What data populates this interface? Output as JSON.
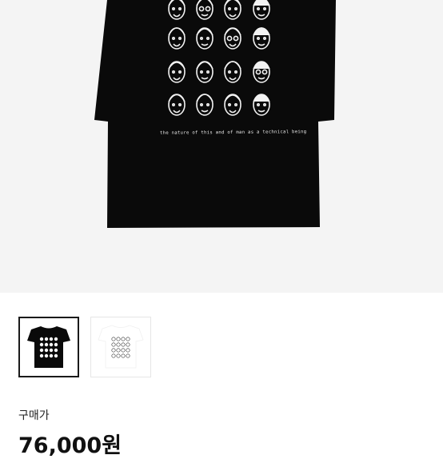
{
  "product": {
    "caption": "the nature of this and of man as a technical being",
    "faces_count": 16,
    "colors": {
      "shirt": "#0a0a0a",
      "print": "#f2f2f2",
      "background": "#f4f4f4"
    }
  },
  "gallery": {
    "thumbnails": [
      {
        "variant": "black",
        "selected": true
      },
      {
        "variant": "white",
        "selected": false
      }
    ]
  },
  "purchase": {
    "label": "구매가",
    "price": "76,000원"
  }
}
